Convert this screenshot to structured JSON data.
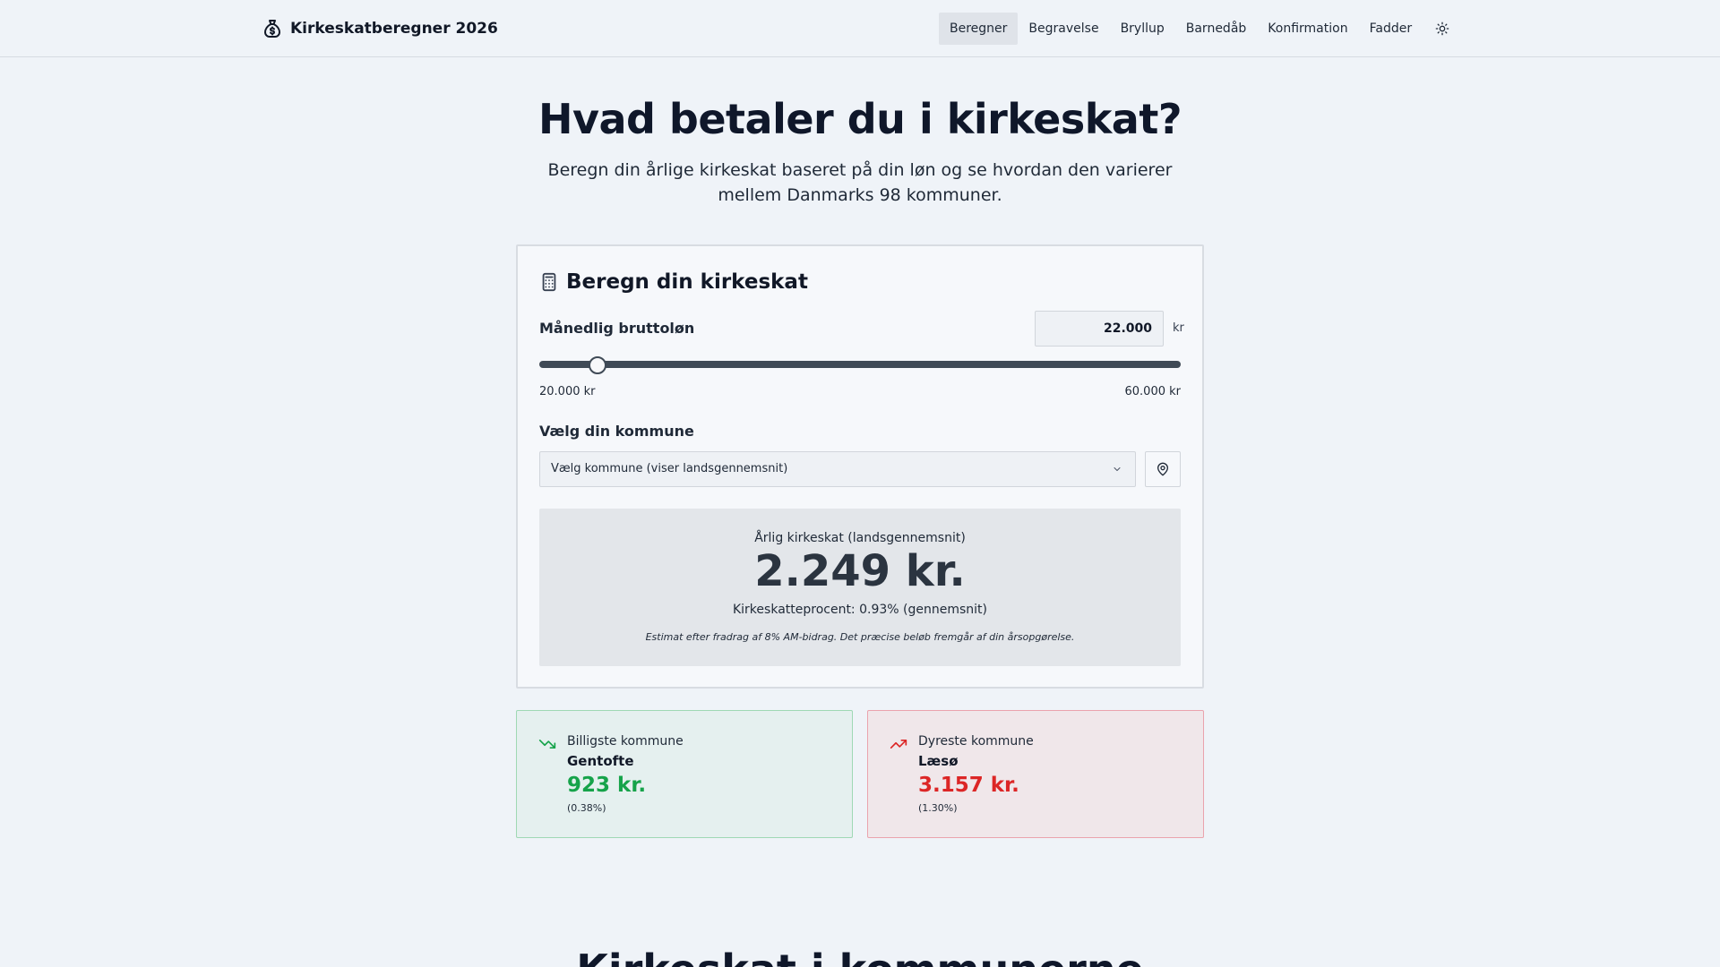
{
  "header": {
    "brand": "Kirkeskatberegner 2026",
    "nav": [
      "Beregner",
      "Begravelse",
      "Bryllup",
      "Barnedåb",
      "Konfirmation",
      "Fadder"
    ],
    "active_nav": "Beregner",
    "theme_icon": "sun-icon"
  },
  "hero": {
    "title": "Hvad betaler du i kirkeskat?",
    "subtitle": "Beregn din årlige kirkeskat baseret på din løn og se hvordan den varierer mellem Danmarks 98 kommuner."
  },
  "calculator": {
    "title": "Beregn din kirkeskat",
    "salary_label": "Månedlig bruttoløn",
    "salary_value": "22.000",
    "salary_unit": "kr",
    "slider": {
      "min": 20000,
      "max": 60000,
      "value": 22000
    },
    "range_min_label": "20.000 kr",
    "range_max_label": "60.000 kr",
    "municipality_label": "Vælg din kommune",
    "municipality_selected": "Vælg kommune (viser landsgennemsnit)",
    "result": {
      "label": "Årlig kirkeskat (landsgennemsnit)",
      "amount": "2.249 kr.",
      "percent": "Kirkeskatteprocent: 0.93% (gennemsnit)",
      "note": "Estimat efter fradrag af 8% AM-bidrag. Det præcise beløb fremgår af din årsopgørelse."
    }
  },
  "cheapest": {
    "label": "Billigste kommune",
    "name": "Gentofte",
    "amount": "923 kr.",
    "percent": "(0.38%)",
    "color": "#16a34a"
  },
  "most_expensive": {
    "label": "Dyreste kommune",
    "name": "Læsø",
    "amount": "3.157 kr.",
    "percent": "(1.30%)",
    "color": "#dc2626"
  },
  "next_section": {
    "title": "Kirkeskat i kommunerne"
  }
}
